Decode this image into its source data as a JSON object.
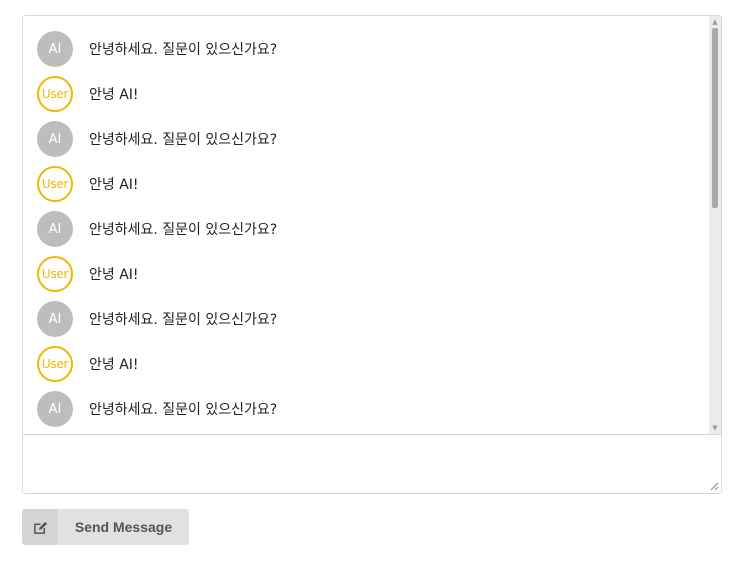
{
  "chat": {
    "messages": [
      {
        "sender": "ai",
        "avatar_label": "AI",
        "text": "안녕하세요. 질문이 있으신가요?"
      },
      {
        "sender": "user",
        "avatar_label": "User",
        "text": "안녕 AI!"
      },
      {
        "sender": "ai",
        "avatar_label": "AI",
        "text": "안녕하세요. 질문이 있으신가요?"
      },
      {
        "sender": "user",
        "avatar_label": "User",
        "text": "안녕 AI!"
      },
      {
        "sender": "ai",
        "avatar_label": "AI",
        "text": "안녕하세요. 질문이 있으신가요?"
      },
      {
        "sender": "user",
        "avatar_label": "User",
        "text": "안녕 AI!"
      },
      {
        "sender": "ai",
        "avatar_label": "AI",
        "text": "안녕하세요. 질문이 있으신가요?"
      },
      {
        "sender": "user",
        "avatar_label": "User",
        "text": "안녕 AI!"
      },
      {
        "sender": "ai",
        "avatar_label": "AI",
        "text": "안녕하세요. 질문이 있으신가요?"
      }
    ]
  },
  "composer": {
    "value": "",
    "placeholder": ""
  },
  "send_button": {
    "label": "Send Message",
    "icon": "edit-icon"
  },
  "colors": {
    "ai_avatar": "#bdbdbd",
    "user_avatar": "#f2b600",
    "button_bg": "#e0e1e2"
  }
}
